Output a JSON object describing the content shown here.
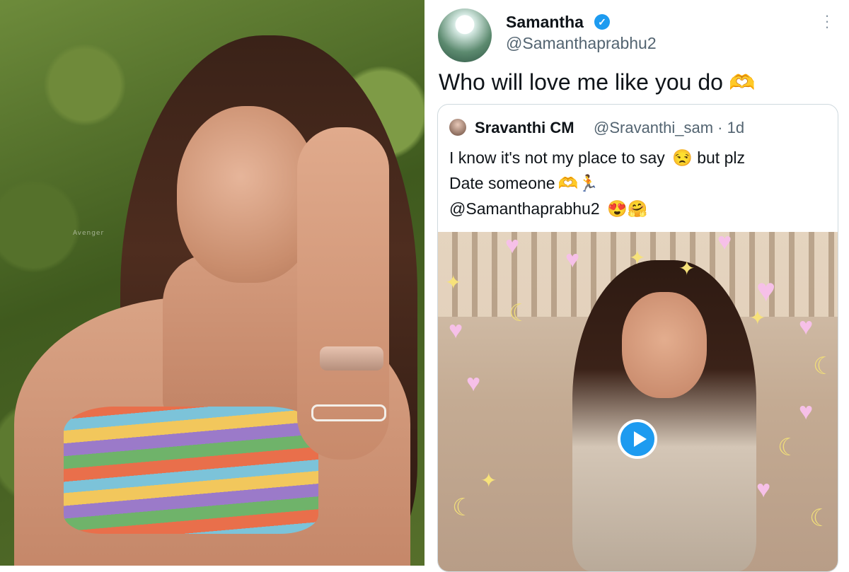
{
  "photo": {
    "watermark": "Avenger"
  },
  "tweet": {
    "author_name": "Samantha",
    "author_handle": "@Samanthaprabhu2",
    "verified_icon": "check-icon",
    "text": "Who will love me like you do",
    "text_emoji": "🫶",
    "menu_icon": "more-vertical-icon",
    "quote": {
      "author_name": "Sravanthi CM",
      "author_handle": "@Sravanthi_sam · 1d",
      "line1": "I know  it's not my place to say",
      "line1_emoji": "😒",
      "line1_tail": "but plz",
      "line2": "Date someone",
      "line2_emoji": "🫶🏃",
      "line3": "@Samanthaprabhu2",
      "line3_emoji": "😍🤗",
      "media_play_icon": "play-icon"
    }
  },
  "colors": {
    "accent": "#1d9bf0",
    "text_primary": "#0f1419",
    "text_secondary": "#536471",
    "border": "#cfd9de"
  }
}
